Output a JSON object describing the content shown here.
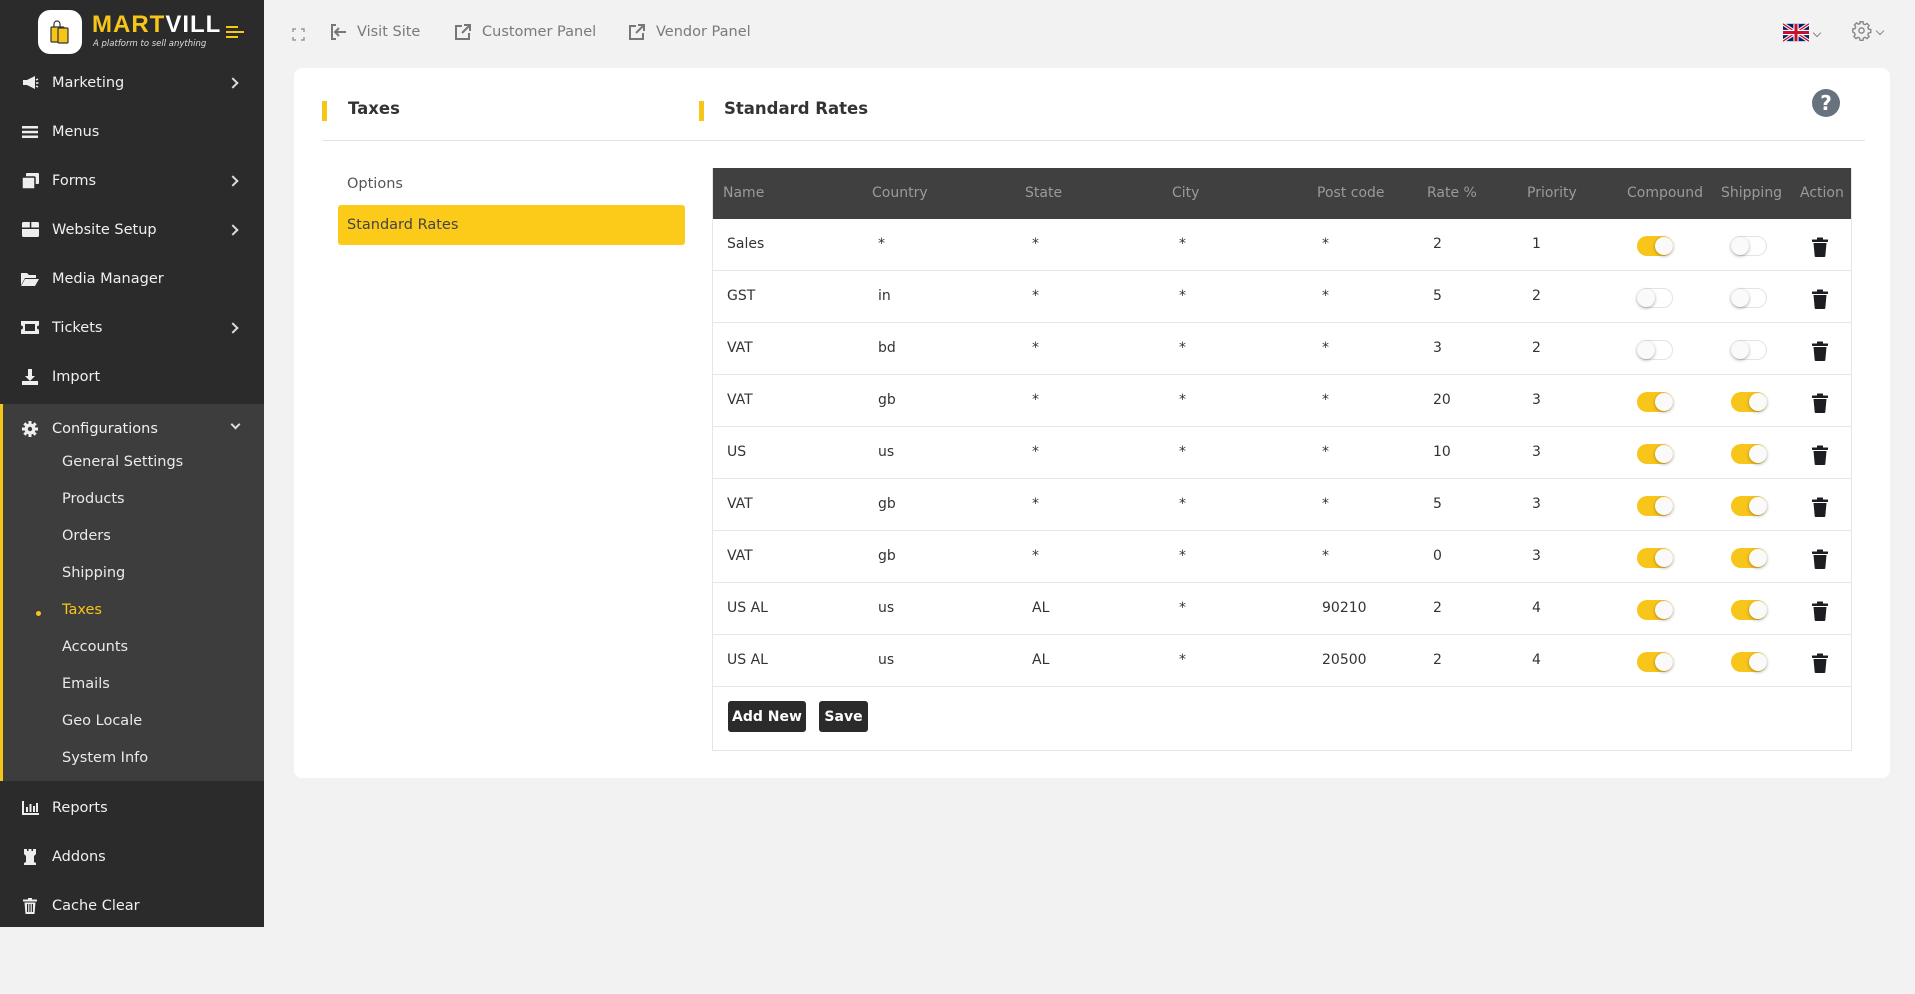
{
  "brand": {
    "name_part1": "MART",
    "name_part2": "VILL",
    "tagline": "A platform to sell anything",
    "accent_color": "#f5c518"
  },
  "topbar": {
    "visit_site": "Visit Site",
    "customer_panel": "Customer Panel",
    "vendor_panel": "Vendor Panel",
    "language_icon": "uk-flag-icon",
    "settings_icon": "gear-icon"
  },
  "sidebar": {
    "items": [
      {
        "label": "Marketing",
        "icon": "megaphone-icon",
        "has_submenu": true
      },
      {
        "label": "Menus",
        "icon": "list-icon",
        "has_submenu": false
      },
      {
        "label": "Forms",
        "icon": "forms-icon",
        "has_submenu": true
      },
      {
        "label": "Website Setup",
        "icon": "box-icon",
        "has_submenu": true
      },
      {
        "label": "Media Manager",
        "icon": "folder-open-icon",
        "has_submenu": false
      },
      {
        "label": "Tickets",
        "icon": "ticket-icon",
        "has_submenu": true
      },
      {
        "label": "Import",
        "icon": "download-icon",
        "has_submenu": false
      },
      {
        "label": "Configurations",
        "icon": "gear-icon",
        "has_submenu": true,
        "expanded": true
      },
      {
        "label": "Reports",
        "icon": "bar-chart-icon",
        "has_submenu": false
      },
      {
        "label": "Addons",
        "icon": "rook-icon",
        "has_submenu": false
      },
      {
        "label": "Cache Clear",
        "icon": "trash-icon",
        "has_submenu": false
      }
    ],
    "config_sub": [
      {
        "label": "General Settings",
        "active": false
      },
      {
        "label": "Products",
        "active": false
      },
      {
        "label": "Orders",
        "active": false
      },
      {
        "label": "Shipping",
        "active": false
      },
      {
        "label": "Taxes",
        "active": true
      },
      {
        "label": "Accounts",
        "active": false
      },
      {
        "label": "Emails",
        "active": false
      },
      {
        "label": "Geo Locale",
        "active": false
      },
      {
        "label": "System Info",
        "active": false
      }
    ]
  },
  "page": {
    "left_title": "Taxes",
    "right_title": "Standard Rates",
    "help_icon": "?",
    "tabs": [
      {
        "label": "Options",
        "active": false
      },
      {
        "label": "Standard Rates",
        "active": true
      }
    ]
  },
  "table": {
    "columns": [
      "Name",
      "Country",
      "State",
      "City",
      "Post code",
      "Rate %",
      "Priority",
      "Compound",
      "Shipping",
      "Action"
    ],
    "rows": [
      {
        "name": "Sales",
        "country": "*",
        "state": "*",
        "city": "*",
        "postcode": "*",
        "rate": "2",
        "priority": "1",
        "compound": true,
        "shipping": false
      },
      {
        "name": "GST",
        "country": "in",
        "state": "*",
        "city": "*",
        "postcode": "*",
        "rate": "5",
        "priority": "2",
        "compound": false,
        "shipping": false
      },
      {
        "name": "VAT",
        "country": "bd",
        "state": "*",
        "city": "*",
        "postcode": "*",
        "rate": "3",
        "priority": "2",
        "compound": false,
        "shipping": false
      },
      {
        "name": "VAT",
        "country": "gb",
        "state": "*",
        "city": "*",
        "postcode": "*",
        "rate": "20",
        "priority": "3",
        "compound": true,
        "shipping": true
      },
      {
        "name": "US",
        "country": "us",
        "state": "*",
        "city": "*",
        "postcode": "*",
        "rate": "10",
        "priority": "3",
        "compound": true,
        "shipping": true
      },
      {
        "name": "VAT",
        "country": "gb",
        "state": "*",
        "city": "*",
        "postcode": "*",
        "rate": "5",
        "priority": "3",
        "compound": true,
        "shipping": true
      },
      {
        "name": "VAT",
        "country": "gb",
        "state": "*",
        "city": "*",
        "postcode": "*",
        "rate": "0",
        "priority": "3",
        "compound": true,
        "shipping": true
      },
      {
        "name": "US AL",
        "country": "us",
        "state": "AL",
        "city": "*",
        "postcode": "90210",
        "rate": "2",
        "priority": "4",
        "compound": true,
        "shipping": true
      },
      {
        "name": "US AL",
        "country": "us",
        "state": "AL",
        "city": "*",
        "postcode": "20500",
        "rate": "2",
        "priority": "4",
        "compound": true,
        "shipping": true
      }
    ],
    "add_new_label": "Add New",
    "save_label": "Save"
  }
}
